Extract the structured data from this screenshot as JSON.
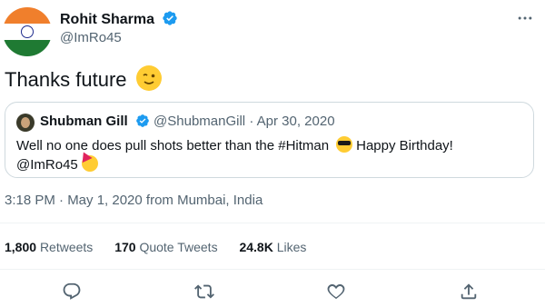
{
  "author": {
    "name": "Rohit Sharma",
    "handle": "@ImRo45"
  },
  "tweet": {
    "text": "Thanks future"
  },
  "quoted": {
    "name": "Shubman Gill",
    "handle": "@ShubmanGill",
    "separator": "·",
    "date": "Apr 30, 2020",
    "text_before": "Well no one does pull shots better than the #Hitman",
    "text_after": "Happy Birthday!",
    "mention": "@ImRo45"
  },
  "meta": {
    "timestamp": "3:18 PM · May 1, 2020 from Mumbai, India"
  },
  "stats": {
    "retweets_count": "1,800",
    "retweets_label": "Retweets",
    "quotes_count": "170",
    "quotes_label": "Quote Tweets",
    "likes_count": "24.8K",
    "likes_label": "Likes"
  },
  "icons": {
    "reply": "reply-icon",
    "retweet": "retweet-icon",
    "like": "heart-icon",
    "share": "share-icon",
    "more": "more-icon",
    "verified": "verified-badge-icon"
  },
  "colors": {
    "verified_blue": "#1d9bf0",
    "secondary_text": "#536471",
    "primary_text": "#0f1419",
    "border": "#cfd9de"
  }
}
